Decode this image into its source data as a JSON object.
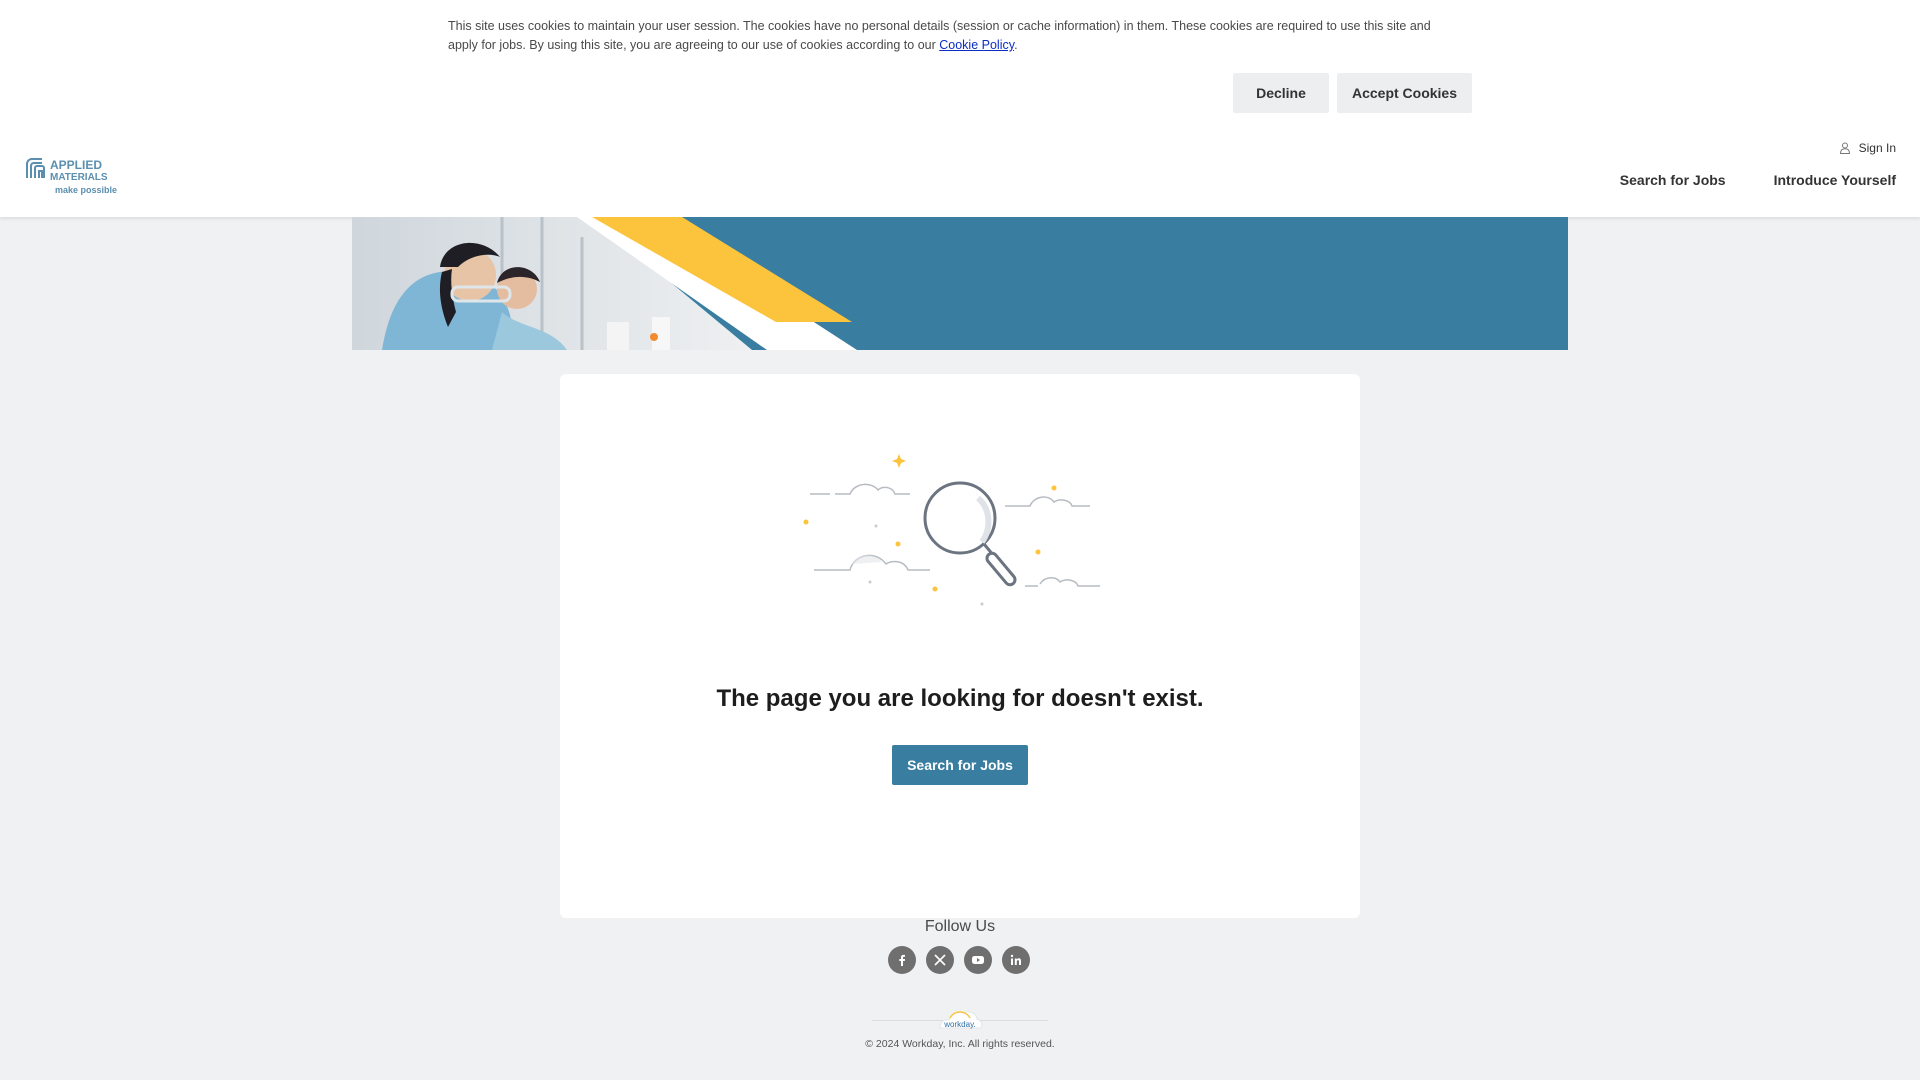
{
  "cookie_banner": {
    "text": "This site uses cookies to maintain your user session.  The cookies have no personal details (session or cache information) in them.  These cookies are required to use this site and apply for jobs.  By using this site, you are agreeing to our use of cookies according to our ",
    "link_text": "Cookie Policy",
    "text_end": ".",
    "decline_label": "Decline",
    "accept_label": "Accept Cookies"
  },
  "header": {
    "logo_line1": "APPLIED",
    "logo_line2": "MATERIALS",
    "logo_tagline": "make possible",
    "signin_label": "Sign In",
    "nav": [
      {
        "label": "Search for Jobs"
      },
      {
        "label": "Introduce Yourself"
      }
    ]
  },
  "main": {
    "title": "The page you are looking for doesn't exist.",
    "button_label": "Search for Jobs"
  },
  "footer": {
    "follow_label": "Follow Us",
    "socials": [
      "facebook-icon",
      "x-twitter-icon",
      "youtube-icon",
      "linkedin-icon"
    ],
    "workday_label": "workday.",
    "copyright": "© 2024 Workday, Inc. All rights reserved."
  },
  "colors": {
    "brand_blue": "#397ea1",
    "accent_yellow": "#fcc43d",
    "background": "#f0f1f2"
  }
}
